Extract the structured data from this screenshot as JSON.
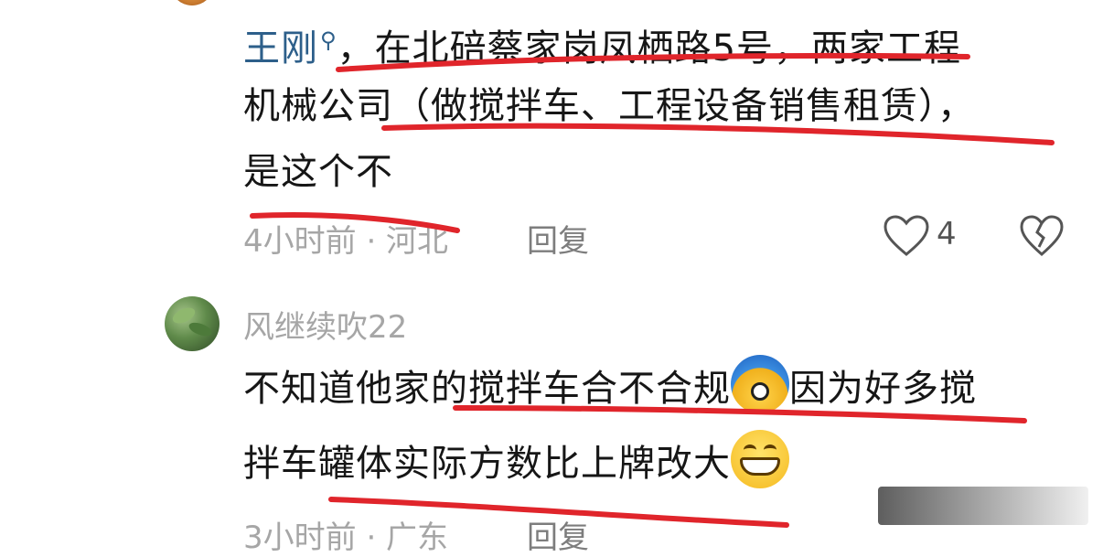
{
  "comment1": {
    "username": "王刚",
    "text_line1_rest": "，在北碚蔡家岗凤栖路5号，两家工程",
    "text_line2": "机械公司（做搅拌车、工程设备销售租赁），",
    "text_line3": "是这个不",
    "time_location": "4小时前 · 河北",
    "reply_label": "回复",
    "like_count": "4"
  },
  "comment2": {
    "username": "风继续吹22",
    "text_line1_a": "不知道他家的搅拌车合不合规",
    "text_line1_b": "因为好多搅",
    "text_line2": "拌车罐体实际方数比上牌改大",
    "time_location": "3小时前 · 广东",
    "reply_label": "回复"
  },
  "icons": {
    "search": "search-icon",
    "like": "heart-outline-icon",
    "dislike": "broken-heart-icon",
    "emoji1": "cool-face-emoji",
    "emoji2": "grinning-face-emoji"
  },
  "colors": {
    "underline": "#e0252b",
    "username_link": "#2d5f8a",
    "meta_gray": "#a6a6a6"
  }
}
